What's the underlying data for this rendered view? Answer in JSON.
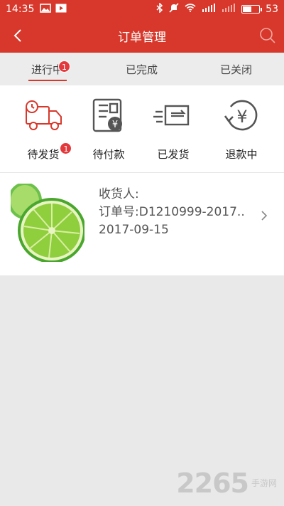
{
  "status_bar": {
    "time": "14:35",
    "battery": "53",
    "battery_level": 0.53
  },
  "nav": {
    "title": "订单管理"
  },
  "tabs": [
    {
      "label": "进行中",
      "badge": "1",
      "active": true
    },
    {
      "label": "已完成",
      "active": false
    },
    {
      "label": "已关闭",
      "active": false
    }
  ],
  "status_items": [
    {
      "label": "待发货",
      "icon": "truck-icon",
      "badge": "1"
    },
    {
      "label": "待付款",
      "icon": "invoice-yuan-icon"
    },
    {
      "label": "已发货",
      "icon": "shipped-package-icon"
    },
    {
      "label": "退款中",
      "icon": "refund-yuan-icon"
    }
  ],
  "order": {
    "receiver_label": "收货人:",
    "order_no": "订单号:D1210999-2017..",
    "date": "2017-09-15"
  },
  "watermark": {
    "brand": "2265",
    "site": "手游网"
  },
  "colors": {
    "primary": "#d8382b",
    "badge": "#e4393c",
    "background": "#e9e9e9"
  }
}
